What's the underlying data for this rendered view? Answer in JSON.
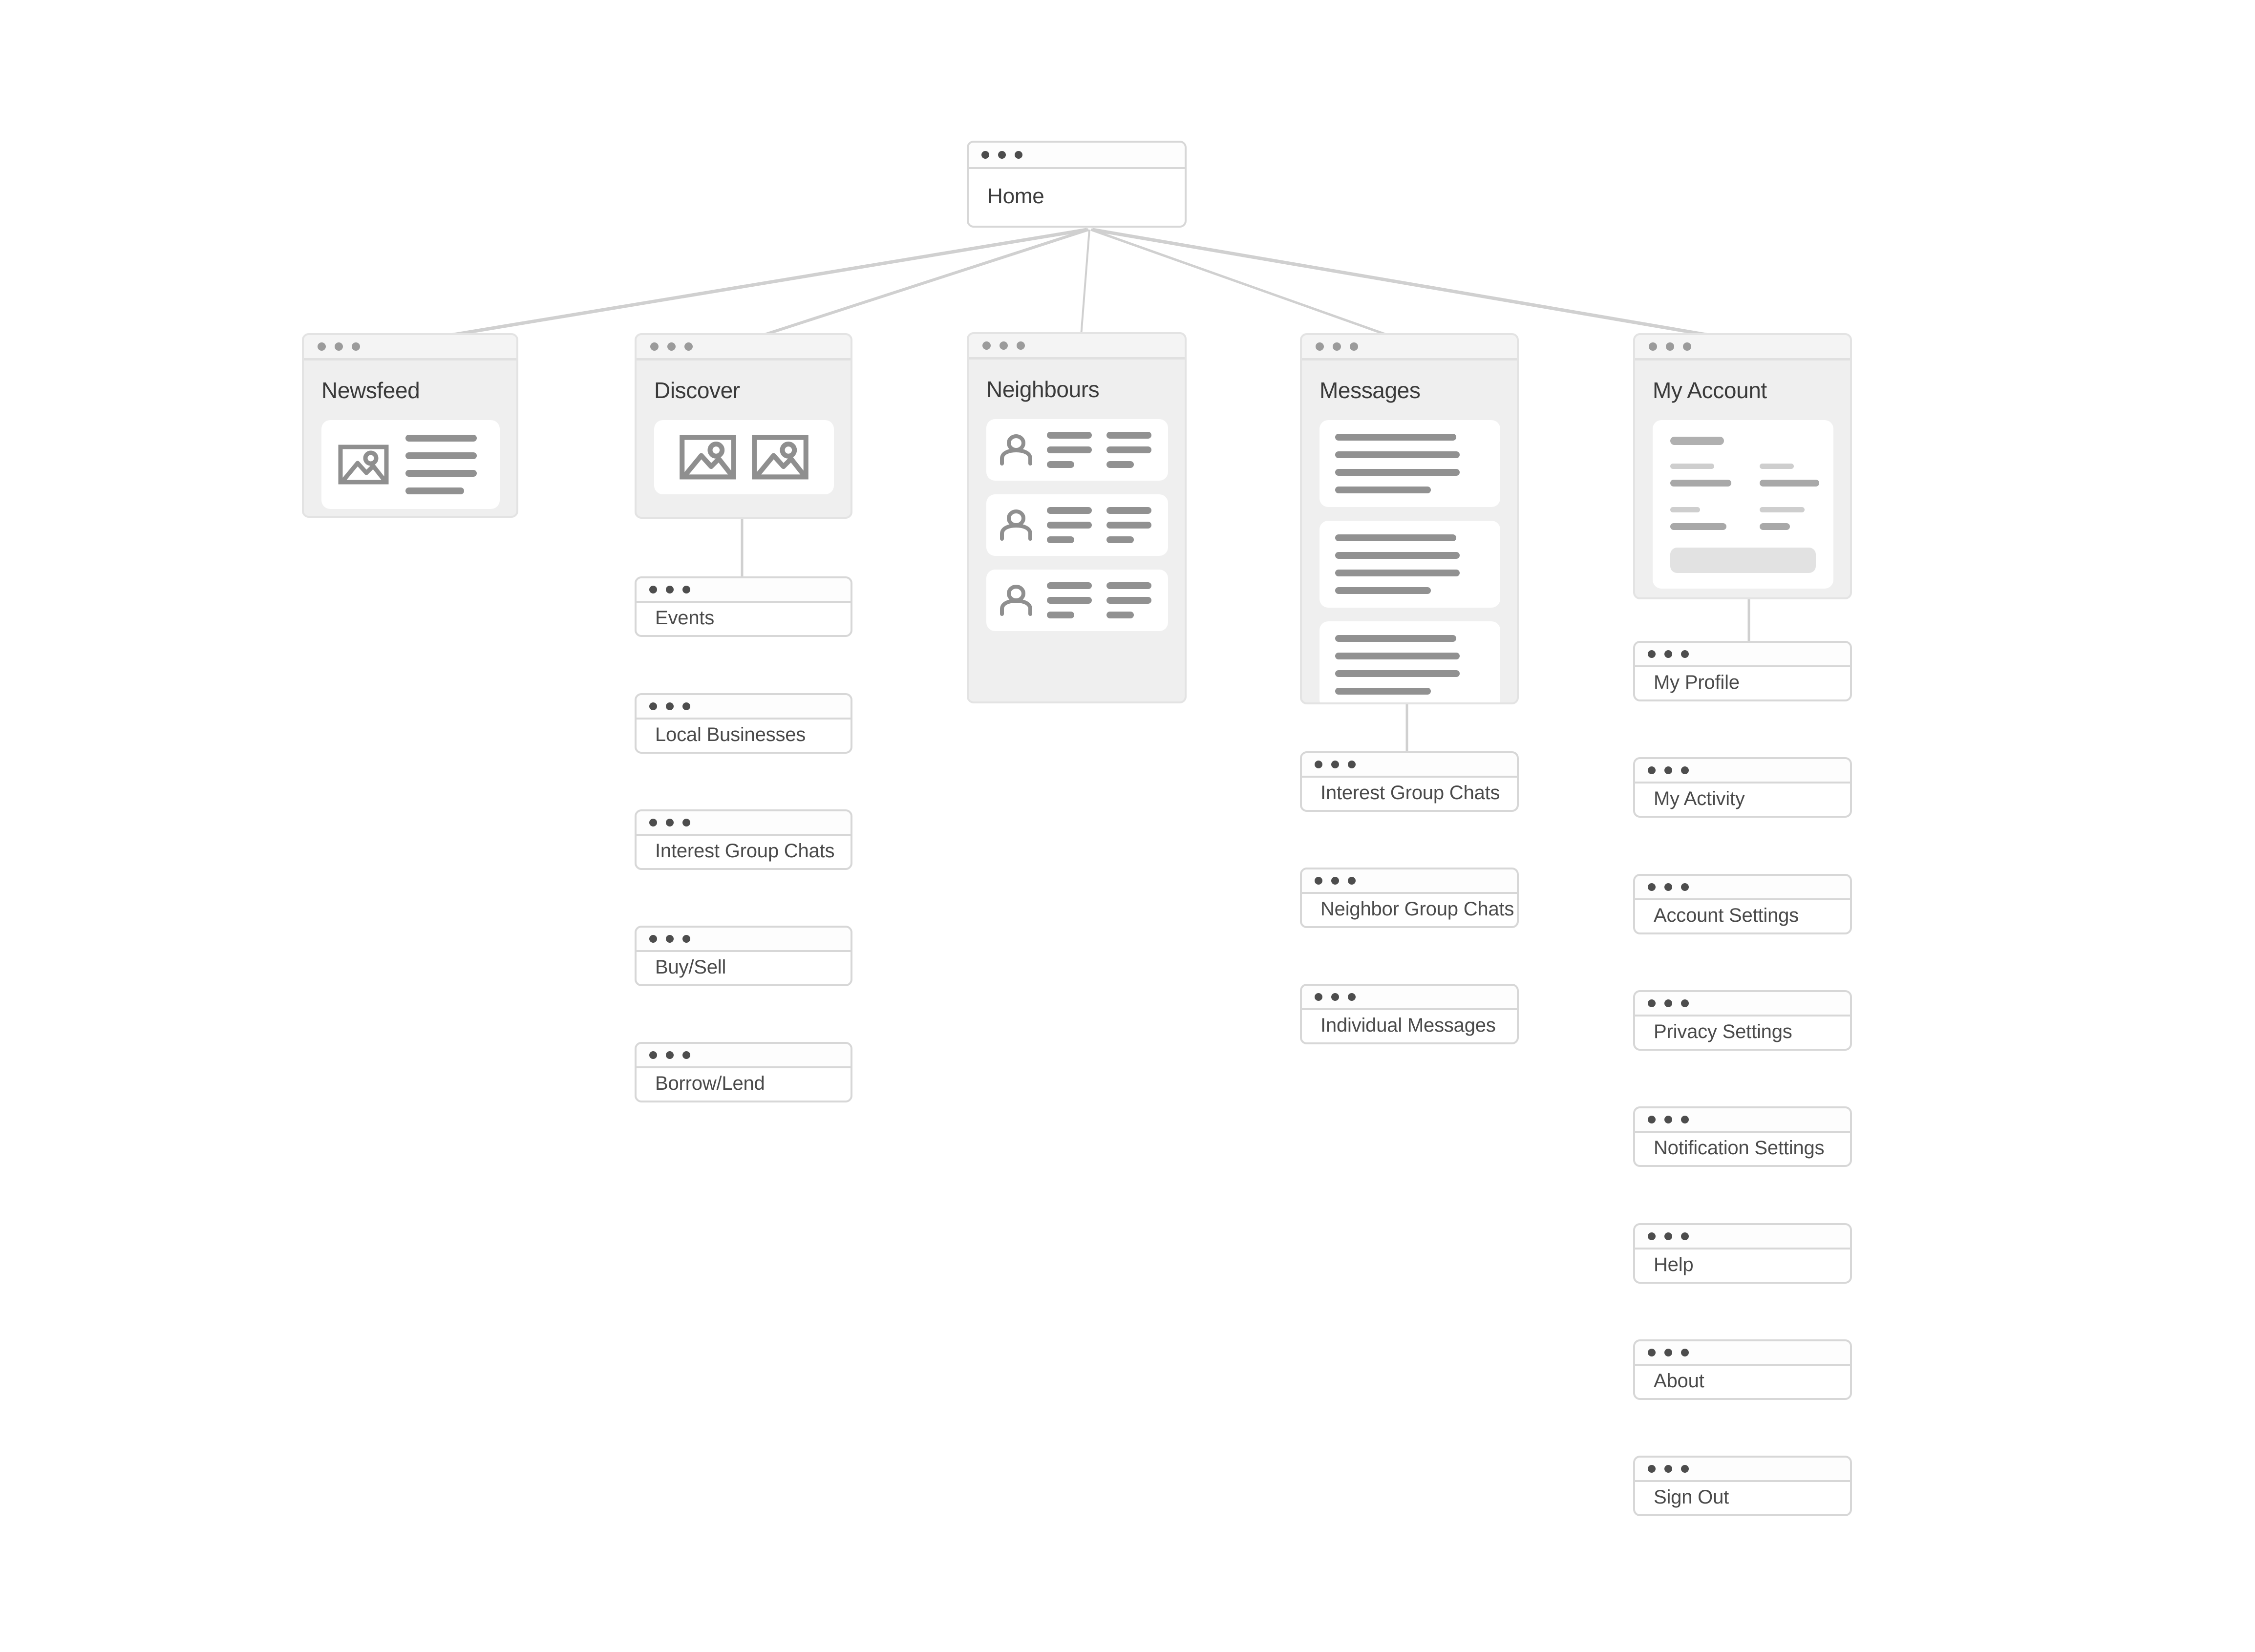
{
  "diagram": {
    "type": "sitemap",
    "root": {
      "label": "Home"
    },
    "sections": [
      {
        "label": "Newsfeed",
        "content": "image-and-text-feed-card"
      },
      {
        "label": "Discover",
        "content": "two-image-tiles-card"
      },
      {
        "label": "Neighbours",
        "content": "three-person-rows"
      },
      {
        "label": "Messages",
        "content": "three-message-cards"
      },
      {
        "label": "My Account",
        "content": "profile-form-card"
      }
    ],
    "children": {
      "newsfeed": [],
      "discover": [
        {
          "label": "Events"
        },
        {
          "label": "Local Businesses"
        },
        {
          "label": "Interest Group Chats"
        },
        {
          "label": "Buy/Sell"
        },
        {
          "label": "Borrow/Lend"
        }
      ],
      "neighbours": [],
      "messages": [
        {
          "label": "Interest Group Chats"
        },
        {
          "label": "Neighbor Group Chats"
        },
        {
          "label": "Individual Messages"
        }
      ],
      "my_account": [
        {
          "label": "My Profile"
        },
        {
          "label": "My Activity"
        },
        {
          "label": "Account Settings"
        },
        {
          "label": "Privacy Settings"
        },
        {
          "label": "Notification Settings"
        },
        {
          "label": "Help"
        },
        {
          "label": "About"
        },
        {
          "label": "Sign Out"
        }
      ]
    },
    "icons": {
      "window_dots": "window-dots-icon",
      "image_placeholder": "image-placeholder-icon",
      "person": "person-avatar-icon"
    },
    "colors": {
      "page_background": "#ffffff",
      "card_background": "#ffffff",
      "section_background": "#efefef",
      "section_bar": "#f4f4f4",
      "border": "#d7d7d7",
      "section_border": "#e3e3e3",
      "connector": "#d0d0d0",
      "title_text": "#3a3a3a",
      "leaf_text": "#4a4a4a",
      "skeleton_line": "#919191",
      "skeleton_label": "#cecece",
      "skeleton_value": "#a8a8a8",
      "skeleton_block": "#e2e2e2",
      "dot_dark": "#4d4d4d",
      "dot_light": "#9b9b9b"
    }
  }
}
